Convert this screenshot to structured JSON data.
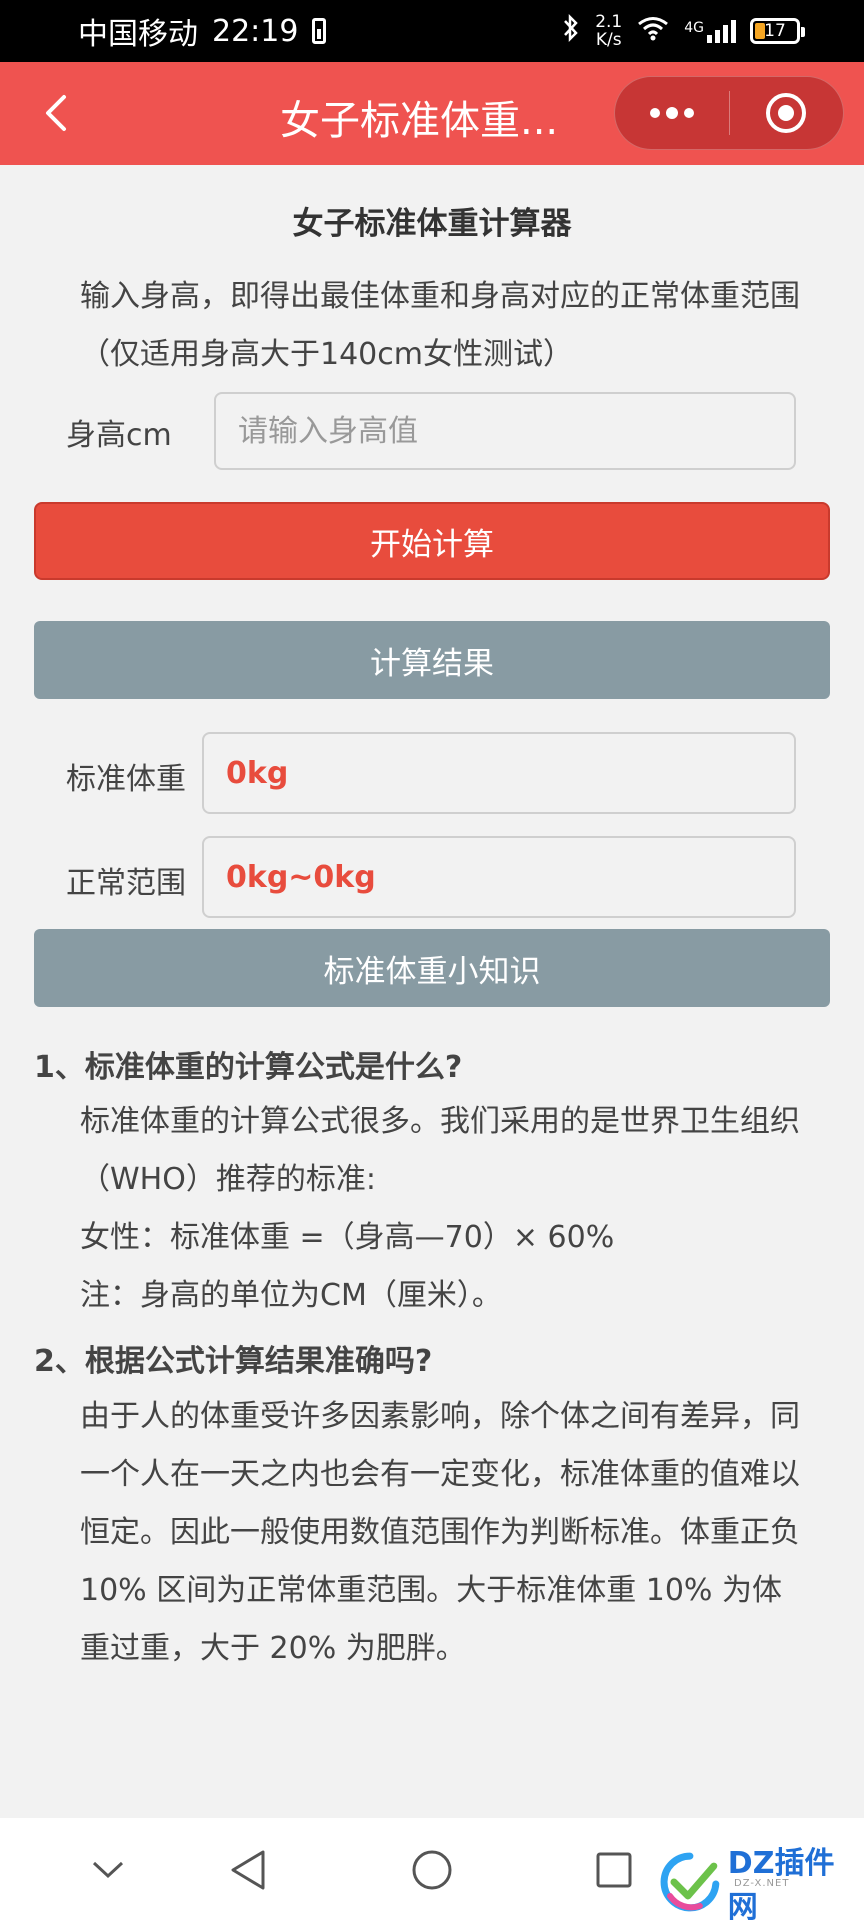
{
  "status_bar": {
    "carrier": "中国移动",
    "time": "22:19",
    "net_speed_value": "2.1",
    "net_speed_unit": "K/s",
    "signal_type": "4G",
    "battery_level": "17"
  },
  "nav": {
    "title": "女子标准体重..."
  },
  "calculator": {
    "heading": "女子标准体重计算器",
    "intro": "输入身高，即得出最佳体重和身高对应的正常体重范围（仅适用身高大于140cm女性测试）",
    "height_label": "身高cm",
    "height_placeholder": "请输入身高值",
    "height_value": "",
    "calc_button": "开始计算"
  },
  "results": {
    "section_title": "计算结果",
    "standard_label": "标准体重",
    "standard_value": "0kg",
    "range_label": "正常范围",
    "range_value": "0kg~0kg"
  },
  "knowledge": {
    "section_title": "标准体重小知识",
    "q1_title": "1、标准体重的计算公式是什么?",
    "q1_p1": "标准体重的计算公式很多。我们采用的是世界卫生组织（WHO）推荐的标准:",
    "q1_p2": "女性：标准体重 =（身高—70）× 60%",
    "q1_p3": "注：身高的单位为CM（厘米）。",
    "q2_title": "2、根据公式计算结果准确吗?",
    "q2_p1": "由于人的体重受许多因素影响，除个体之间有差异，同一个人在一天之内也会有一定变化，标准体重的值难以恒定。因此一般使用数值范围作为判断标准。体重正负 10% 区间为正常体重范围。大于标准体重 10% 为体重过重，大于 20% 为肥胖。"
  },
  "watermark": {
    "text": "DZ插件网",
    "sub": "DZ-X.NET"
  },
  "colors": {
    "nav_bg": "#ef5350",
    "button_red": "#e84c3d",
    "section_gray": "#889ba3",
    "result_red": "#e84c3d"
  }
}
